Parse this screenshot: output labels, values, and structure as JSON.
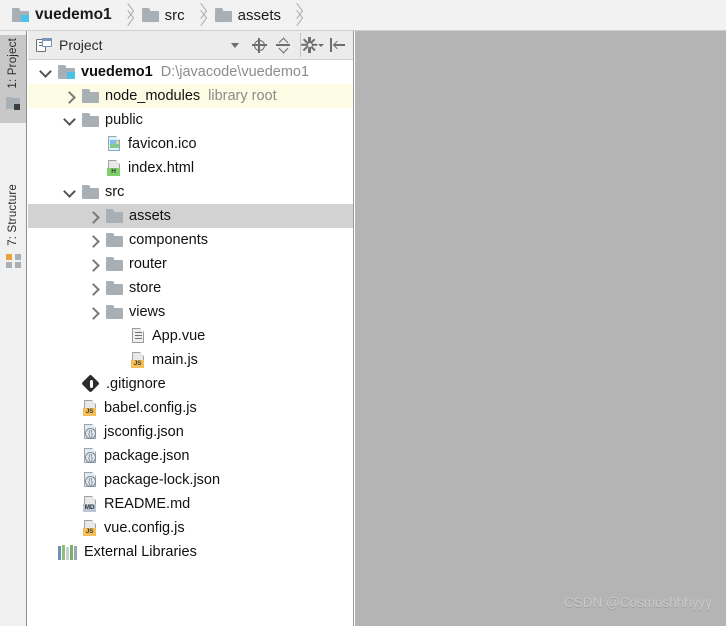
{
  "breadcrumb": {
    "items": [
      {
        "label": "vuedemo1",
        "icon": "folder-project-icon",
        "root": true
      },
      {
        "label": "src",
        "icon": "folder-icon",
        "root": false
      },
      {
        "label": "assets",
        "icon": "folder-icon",
        "root": false
      }
    ]
  },
  "left_strip": {
    "tabs": [
      {
        "label": "1: Project",
        "icon": "project-window-icon",
        "selected": true
      },
      {
        "label": "7: Structure",
        "icon": "structure-window-icon",
        "selected": false
      }
    ]
  },
  "tool_window": {
    "title": "Project",
    "title_icon": "project-view-icon",
    "toolbar": [
      {
        "name": "view-options-dropdown",
        "icon": "chevron-down-icon"
      },
      {
        "name": "scroll-from-source-button",
        "icon": "crosshair-locate-icon"
      },
      {
        "name": "collapse-all-button",
        "icon": "collapse-all-icon"
      },
      {
        "name": "settings-button",
        "icon": "gear-icon"
      },
      {
        "name": "hide-panel-button",
        "icon": "hide-panel-icon"
      }
    ]
  },
  "tree": {
    "rows": [
      {
        "name": "project-root",
        "label": "vuedemo1",
        "sub": "D:\\javacode\\vuedemo1",
        "indent": 0,
        "arrow": "down",
        "icon": "folder-project-icon",
        "bold": true,
        "state": "normal"
      },
      {
        "name": "node-modules",
        "label": "node_modules",
        "sub": "library root",
        "indent": 1,
        "arrow": "right",
        "icon": "folder-icon",
        "bold": false,
        "state": "highlight"
      },
      {
        "name": "public-folder",
        "label": "public",
        "sub": "",
        "indent": 1,
        "arrow": "down",
        "icon": "folder-icon",
        "bold": false,
        "state": "normal"
      },
      {
        "name": "favicon-ico",
        "label": "favicon.ico",
        "sub": "",
        "indent": 2,
        "arrow": "none",
        "icon": "image-file-icon",
        "bold": false,
        "state": "normal"
      },
      {
        "name": "index-html",
        "label": "index.html",
        "sub": "",
        "indent": 2,
        "arrow": "none",
        "icon": "html-file-icon",
        "bold": false,
        "state": "normal"
      },
      {
        "name": "src-folder",
        "label": "src",
        "sub": "",
        "indent": 1,
        "arrow": "down",
        "icon": "folder-icon",
        "bold": false,
        "state": "normal"
      },
      {
        "name": "assets-folder",
        "label": "assets",
        "sub": "",
        "indent": 2,
        "arrow": "right",
        "icon": "folder-icon",
        "bold": false,
        "state": "selected"
      },
      {
        "name": "components-folder",
        "label": "components",
        "sub": "",
        "indent": 2,
        "arrow": "right",
        "icon": "folder-icon",
        "bold": false,
        "state": "normal"
      },
      {
        "name": "router-folder",
        "label": "router",
        "sub": "",
        "indent": 2,
        "arrow": "right",
        "icon": "folder-icon",
        "bold": false,
        "state": "normal"
      },
      {
        "name": "store-folder",
        "label": "store",
        "sub": "",
        "indent": 2,
        "arrow": "right",
        "icon": "folder-icon",
        "bold": false,
        "state": "normal"
      },
      {
        "name": "views-folder",
        "label": "views",
        "sub": "",
        "indent": 2,
        "arrow": "right",
        "icon": "folder-icon",
        "bold": false,
        "state": "normal"
      },
      {
        "name": "app-vue",
        "label": "App.vue",
        "sub": "",
        "indent": 3,
        "arrow": "none",
        "icon": "vue-file-icon",
        "bold": false,
        "state": "normal"
      },
      {
        "name": "main-js",
        "label": "main.js",
        "sub": "",
        "indent": 3,
        "arrow": "none",
        "icon": "js-file-icon",
        "bold": false,
        "state": "normal"
      },
      {
        "name": "gitignore-file",
        "label": ".gitignore",
        "sub": "",
        "indent": 1,
        "arrow": "none",
        "icon": "git-file-icon",
        "bold": false,
        "state": "normal"
      },
      {
        "name": "babel-config-js",
        "label": "babel.config.js",
        "sub": "",
        "indent": 1,
        "arrow": "none",
        "icon": "js-file-icon",
        "bold": false,
        "state": "normal"
      },
      {
        "name": "jsconfig-json",
        "label": "jsconfig.json",
        "sub": "",
        "indent": 1,
        "arrow": "none",
        "icon": "json-file-icon",
        "bold": false,
        "state": "normal"
      },
      {
        "name": "package-json",
        "label": "package.json",
        "sub": "",
        "indent": 1,
        "arrow": "none",
        "icon": "json-file-icon",
        "bold": false,
        "state": "normal"
      },
      {
        "name": "package-lock-json",
        "label": "package-lock.json",
        "sub": "",
        "indent": 1,
        "arrow": "none",
        "icon": "json-file-icon",
        "bold": false,
        "state": "normal"
      },
      {
        "name": "readme-md",
        "label": "README.md",
        "sub": "",
        "indent": 1,
        "arrow": "none",
        "icon": "md-file-icon",
        "bold": false,
        "state": "normal"
      },
      {
        "name": "vue-config-js",
        "label": "vue.config.js",
        "sub": "",
        "indent": 1,
        "arrow": "none",
        "icon": "js-file-icon",
        "bold": false,
        "state": "normal"
      },
      {
        "name": "external-libraries",
        "label": "External Libraries",
        "sub": "",
        "indent": 0,
        "arrow": "none",
        "icon": "external-libraries-icon",
        "bold": false,
        "state": "normal"
      }
    ]
  },
  "editor": {
    "watermark": "CSDN @Cosmoshhhyyy"
  },
  "colors": {
    "selection": "#d2d2d2",
    "highlight_row": "#fcfbe3",
    "editor_bg": "#b4b4b4",
    "folder": "#a9b0b5",
    "badge_blue": "#4bc3e8"
  }
}
